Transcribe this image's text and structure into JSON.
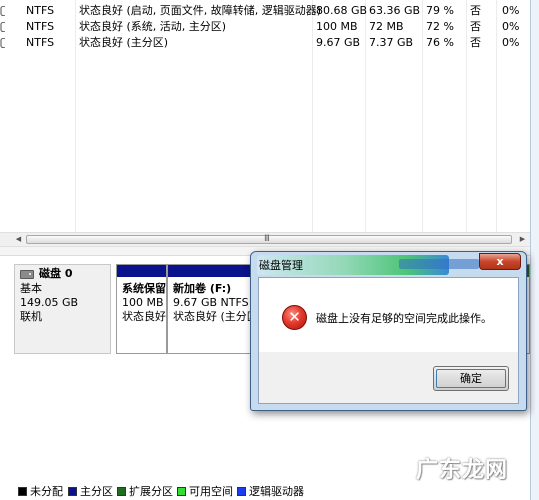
{
  "volume_list": {
    "edge_mark": "ʗ",
    "rows": [
      {
        "fs": "NTFS",
        "status": "状态良好 (启动, 页面文件, 故障转储, 逻辑驱动器)",
        "capacity": "80.68 GB",
        "free": "63.36 GB",
        "pct": "79 %",
        "fault_tolerance": "否",
        "overhead": "0%"
      },
      {
        "fs": "NTFS",
        "status": "状态良好 (系统, 活动, 主分区)",
        "capacity": "100 MB",
        "free": "72 MB",
        "pct": "72 %",
        "fault_tolerance": "否",
        "overhead": "0%"
      },
      {
        "fs": "NTFS",
        "status": "状态良好 (主分区)",
        "capacity": "9.67 GB",
        "free": "7.37 GB",
        "pct": "76 %",
        "fault_tolerance": "否",
        "overhead": "0%"
      }
    ]
  },
  "scrollbar": {
    "left_arrow": "◀",
    "right_arrow": "▶",
    "grip": "III"
  },
  "disk": {
    "name": "磁盘 0",
    "type": "基本",
    "size": "149.05 GB",
    "state": "联机",
    "partitions": [
      {
        "name": "系统保留",
        "size": "100 MB",
        "status": "状态良好"
      },
      {
        "name": "新加卷  (F:)",
        "size": "9.67 GB NTFS",
        "status": "状态良好 (主分区"
      }
    ]
  },
  "legend": [
    {
      "label": "未分配",
      "color": "#000000"
    },
    {
      "label": "主分区",
      "color": "#0a128c"
    },
    {
      "label": "扩展分区",
      "color": "#1f6b1f"
    },
    {
      "label": "可用空间",
      "color": "#33dd33"
    },
    {
      "label": "逻辑驱动器",
      "color": "#1c3cf0"
    }
  ],
  "dialog": {
    "title": "磁盘管理",
    "close_glyph": "x",
    "error_glyph": "✕",
    "message": "磁盘上没有足够的空间完成此操作。",
    "ok_label": "确定"
  },
  "watermark": "广东龙网"
}
